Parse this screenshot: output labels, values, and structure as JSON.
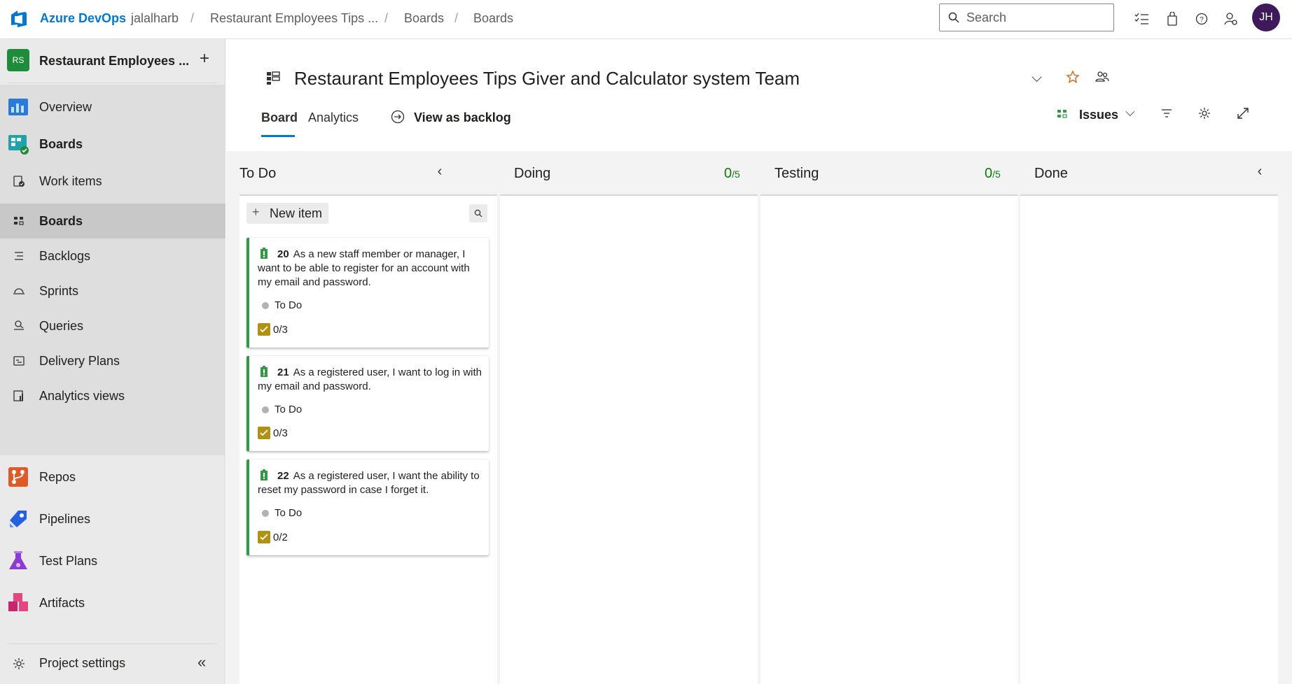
{
  "topbar": {
    "brand": "Azure DevOps",
    "breadcrumbs": [
      "jalalharb",
      "Restaurant Employees Tips ...",
      "Boards",
      "Boards"
    ],
    "search_placeholder": "Search",
    "avatar_initials": "JH"
  },
  "sidebar": {
    "project_initials": "RS",
    "project_name": "Restaurant Employees ...",
    "items": [
      {
        "label": "Overview",
        "icon": "overview-icon"
      },
      {
        "label": "Boards",
        "icon": "boards-hub-icon"
      },
      {
        "label": "Work items",
        "icon": "work-items-icon"
      },
      {
        "label": "Boards",
        "icon": "boards-icon"
      },
      {
        "label": "Backlogs",
        "icon": "backlogs-icon"
      },
      {
        "label": "Sprints",
        "icon": "sprints-icon"
      },
      {
        "label": "Queries",
        "icon": "queries-icon"
      },
      {
        "label": "Delivery Plans",
        "icon": "delivery-plans-icon"
      },
      {
        "label": "Analytics views",
        "icon": "analytics-views-icon"
      },
      {
        "label": "Repos",
        "icon": "repos-icon"
      },
      {
        "label": "Pipelines",
        "icon": "pipelines-icon"
      },
      {
        "label": "Test Plans",
        "icon": "test-plans-icon"
      },
      {
        "label": "Artifacts",
        "icon": "artifacts-icon"
      }
    ],
    "settings_label": "Project settings"
  },
  "header": {
    "team_title": "Restaurant Employees Tips Giver and Calculator system Team",
    "tabs": [
      "Board",
      "Analytics"
    ],
    "view_as_backlog": "View as backlog",
    "backlog_level": "Issues"
  },
  "board": {
    "columns": [
      {
        "title": "To Do",
        "wip": ""
      },
      {
        "title": "Doing",
        "wip_count": "0",
        "wip_limit": "/5"
      },
      {
        "title": "Testing",
        "wip_count": "0",
        "wip_limit": "/5"
      },
      {
        "title": "Done",
        "wip": ""
      }
    ],
    "new_item_label": "New item",
    "cards": [
      {
        "id": "20",
        "title": "As a new staff member or manager, I want to be able to register for an account with my email and password.",
        "state": "To Do",
        "tasks": "0/3"
      },
      {
        "id": "21",
        "title": "As a registered user, I want to log in with my email and password.",
        "state": "To Do",
        "tasks": "0/3"
      },
      {
        "id": "22",
        "title": "As a registered user, I want the ability to reset my password in case I forget it.",
        "state": "To Do",
        "tasks": "0/2"
      }
    ]
  },
  "colors": {
    "accent": "#0078d4",
    "card_border": "#339947",
    "wip": "#107c10",
    "task_check": "#b19114",
    "avatar_bg": "#3e1a5c",
    "project_badge": "#1e8c3a"
  }
}
